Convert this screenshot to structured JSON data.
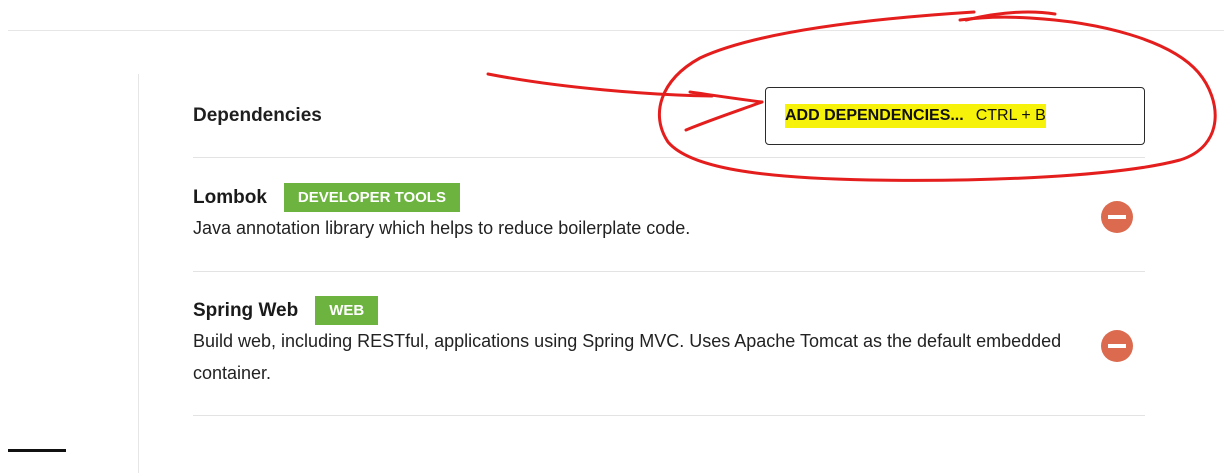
{
  "dependencies": {
    "title": "Dependencies",
    "add_button": {
      "label": "ADD DEPENDENCIES...",
      "shortcut": "CTRL + B"
    },
    "items": [
      {
        "name": "Lombok",
        "tag": "DEVELOPER TOOLS",
        "description": "Java annotation library which helps to reduce boilerplate code."
      },
      {
        "name": "Spring Web",
        "tag": "WEB",
        "description": "Build web, including RESTful, applications using Spring MVC. Uses Apache Tomcat as the default embedded container."
      }
    ]
  },
  "colors": {
    "tag_background": "#6db33f",
    "remove_button": "#db6a4f",
    "highlight": "#f7f20a",
    "annotation_ink": "#e41d1d"
  },
  "icons": {
    "remove": "remove-circle-icon"
  }
}
